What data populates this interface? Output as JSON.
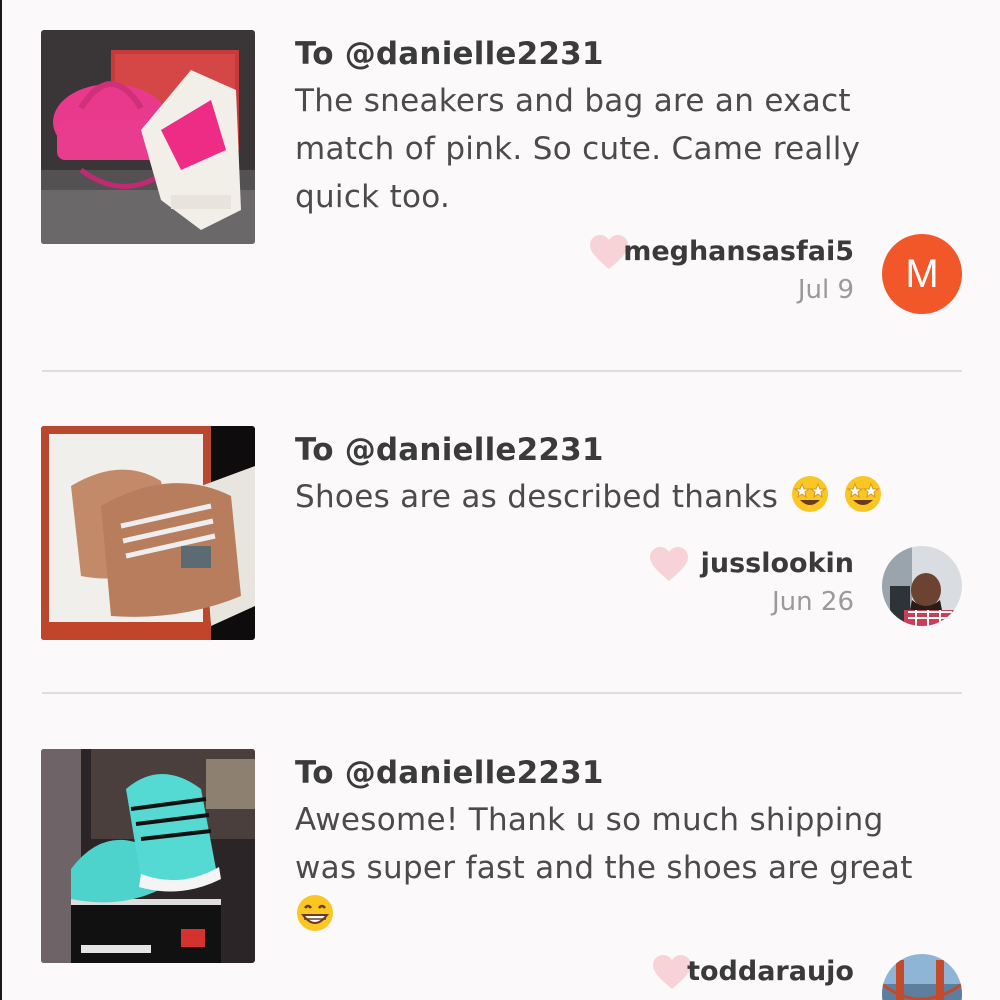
{
  "reviews": [
    {
      "to": "To @danielle2231",
      "lines": [
        "The sneakers and bag are an exact",
        "match of pink. So cute. Came really",
        "quick too."
      ],
      "username": "meghansasfai5",
      "date": "Jul 9",
      "avatar_letter": "M",
      "avatar_color": "#f2572a",
      "image_subject": "pink-bag-and-sneakers"
    },
    {
      "to": "To @danielle2231",
      "lines": [
        "Shoes are as described thanks"
      ],
      "emojis": [
        "star-struck-icon",
        "star-struck-icon"
      ],
      "username": "jusslookin",
      "date": "Jun 26",
      "image_subject": "rose-gold-sneakers-in-box"
    },
    {
      "to": "To @danielle2231",
      "lines": [
        "Awesome! Thank u so much shipping",
        "was super fast and the shoes are great"
      ],
      "emojis": [
        "grinning-face-icon"
      ],
      "username": "toddaraujo",
      "image_subject": "teal-sneakers-on-box"
    }
  ],
  "colors": {
    "background": "#fbf9fa",
    "heart": "#f7d3d7",
    "divider": "#e0dddf",
    "secondary_text": "#9a9a9a"
  }
}
